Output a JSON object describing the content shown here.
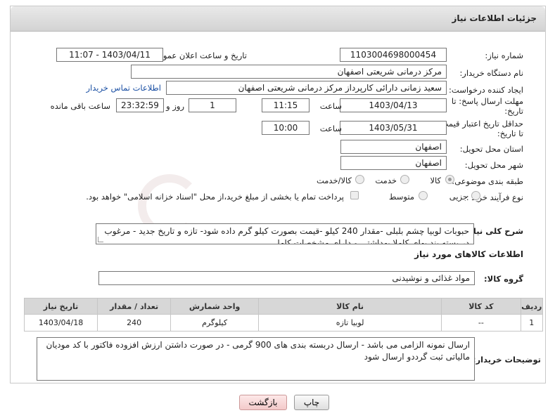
{
  "header": {
    "title": "جزئیات اطلاعات نیاز"
  },
  "fields": {
    "need_number_label": "شماره نیاز:",
    "need_number": "1103004698000454",
    "announce_label": "تاریخ و ساعت اعلان عمومی:",
    "announce_value": "1403/04/11 - 11:07",
    "buyer_org_label": "نام دستگاه خریدار:",
    "buyer_org": "مرکز درمانی شریعتی اصفهان",
    "requester_label": "ایجاد کننده درخواست:",
    "requester": "سعید زمانی دارائی کارپرداز مرکز درمانی شریعتی اصفهان",
    "contact_link": "اطلاعات تماس خریدار",
    "deadline_label": "مهلت ارسال پاسخ: تا تاریخ:",
    "deadline_date": "1403/04/13",
    "time_label": "ساعت",
    "deadline_time": "11:15",
    "days_value": "1",
    "days_label": "روز و",
    "remaining_time": "23:32:59",
    "remaining_label": "ساعت باقی مانده",
    "validity_label": "حداقل تاریخ اعتبار قیمت: تا تاریخ:",
    "validity_date": "1403/05/31",
    "validity_time": "10:00",
    "province_label": "استان محل تحویل:",
    "province": "اصفهان",
    "city_label": "شهر محل تحویل:",
    "city": "اصفهان",
    "category_label": "طبقه بندی موضوعی:",
    "category_options": [
      "کالا",
      "خدمت",
      "کالا/خدمت"
    ],
    "process_label": "نوع فرآیند خرید :",
    "process_options": [
      "جزیی",
      "متوسط"
    ],
    "payment_note": "پرداخت تمام یا بخشی از مبلغ خرید،از محل \"اسناد خزانه اسلامی\" خواهد بود.",
    "description_label": "شرح کلی نیاز:",
    "description": "حبوبات لوبیا چشم بلبلی  -مقدار 240 کیلو  -قیمت بصورت کیلو گرم داده شود- تازه و تاریخ جدید - مرغوب در بسته بند یهای کاملا بهداشتی و دارای مشخصات کامل",
    "goods_info_title": "اطلاعات کالاهای مورد نیاز",
    "goods_group_label": "گروه کالا:",
    "goods_group": "مواد غذائی و نوشیدنی",
    "buyer_notes_label": "توضیحات خریدار:",
    "buyer_notes": "ارسال نمونه الزامی می باشد - ارسال دربسته بندی های 900 گرمی - در صورت داشتن ارزش افزوده فاکتور با کد مودیان مالیاتی ثبت گرددو ارسال شود"
  },
  "table": {
    "headers": [
      "ردیف",
      "کد کالا",
      "نام کالا",
      "واحد شمارش",
      "تعداد / مقدار",
      "تاریخ نیاز"
    ],
    "rows": [
      [
        "1",
        "--",
        "لوبیا تازه",
        "کیلوگرم",
        "240",
        "1403/04/18"
      ]
    ]
  },
  "buttons": {
    "print": "چاپ",
    "back": "بازگشت"
  }
}
